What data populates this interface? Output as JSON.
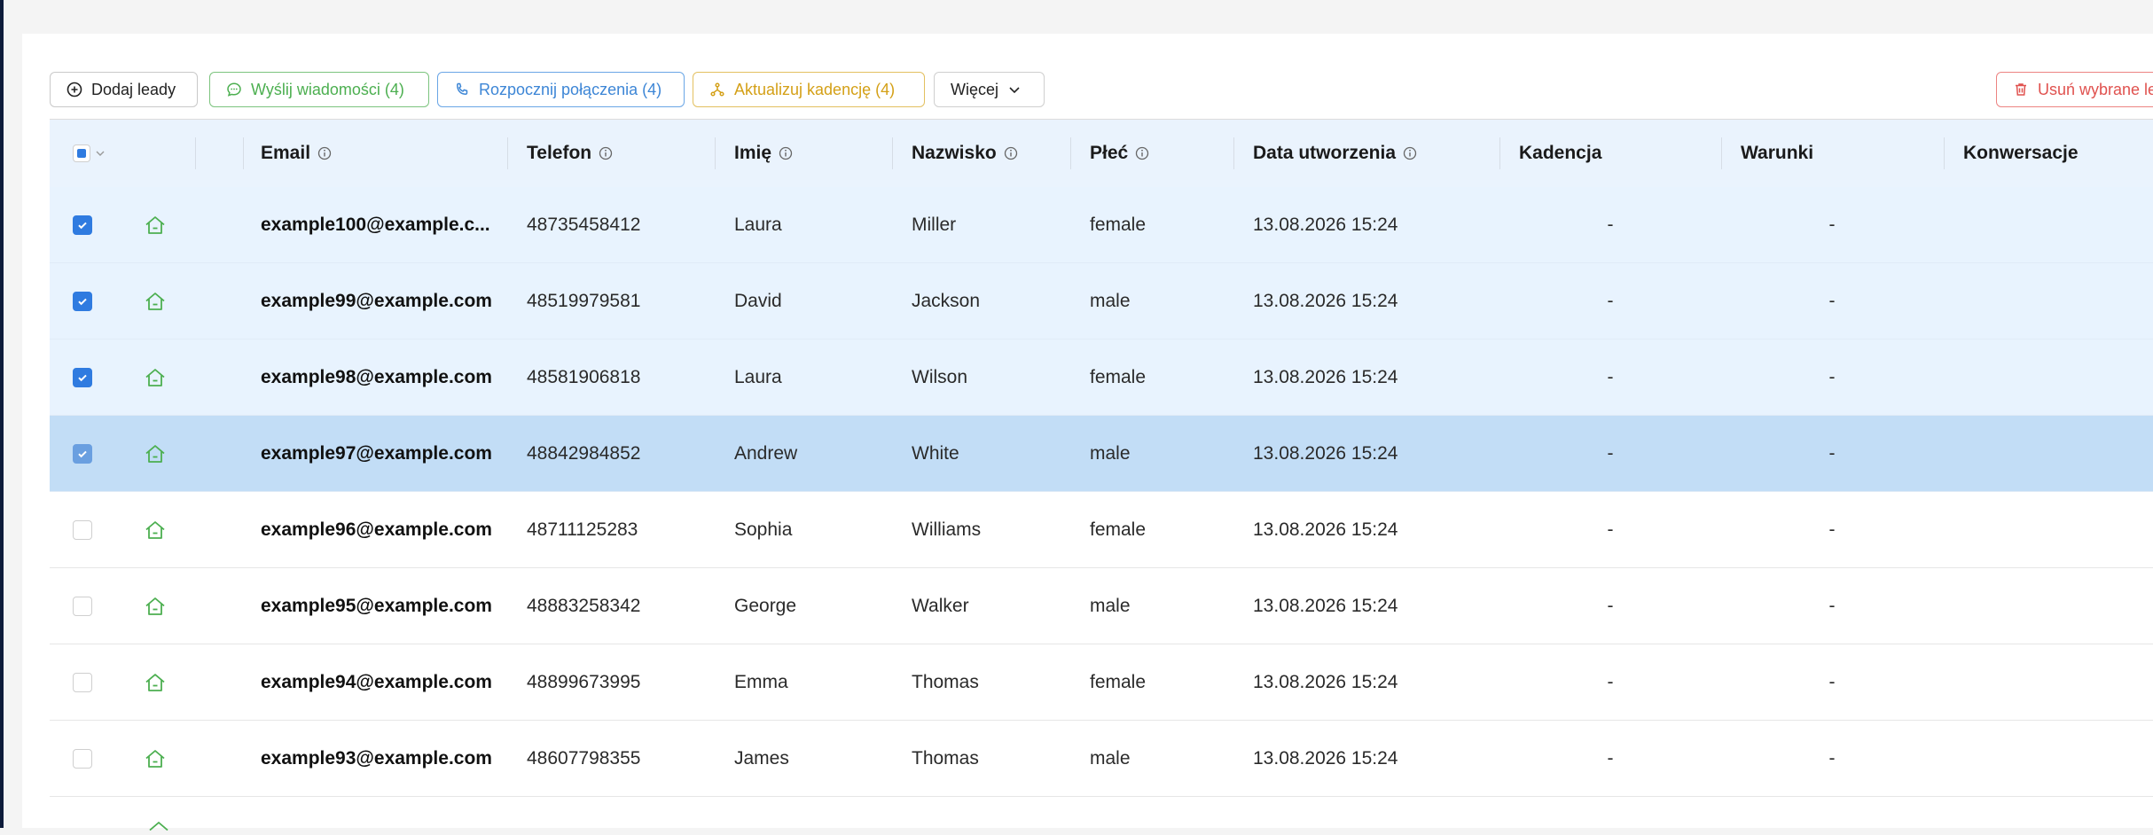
{
  "toolbar": {
    "add_label": "Dodaj leady",
    "send_label": "Wyślij wiadomości (4)",
    "call_label": "Rozpocznij połączenia (4)",
    "cadence_label": "Aktualizuj kadencję (4)",
    "more_label": "Więcej",
    "delete_label": "Usuń wybrane leady"
  },
  "columns": {
    "email": "Email",
    "phone": "Telefon",
    "first_name": "Imię",
    "last_name": "Nazwisko",
    "gender": "Płeć",
    "created": "Data utworzenia",
    "cadence": "Kadencja",
    "conditions": "Warunki",
    "conversations": "Konwersacje"
  },
  "rows": [
    {
      "email": "example100@example.c...",
      "phone": "48735458412",
      "first_name": "Laura",
      "last_name": "Miller",
      "gender": "female",
      "created": "13.08.2026 15:24",
      "cadence": "-",
      "conditions": "-",
      "checked": true
    },
    {
      "email": "example99@example.com",
      "phone": "48519979581",
      "first_name": "David",
      "last_name": "Jackson",
      "gender": "male",
      "created": "13.08.2026 15:24",
      "cadence": "-",
      "conditions": "-",
      "checked": true
    },
    {
      "email": "example98@example.com",
      "phone": "48581906818",
      "first_name": "Laura",
      "last_name": "Wilson",
      "gender": "female",
      "created": "13.08.2026 15:24",
      "cadence": "-",
      "conditions": "-",
      "checked": true
    },
    {
      "email": "example97@example.com",
      "phone": "48842984852",
      "first_name": "Andrew",
      "last_name": "White",
      "gender": "male",
      "created": "13.08.2026 15:24",
      "cadence": "-",
      "conditions": "-",
      "checked": true
    },
    {
      "email": "example96@example.com",
      "phone": "48711125283",
      "first_name": "Sophia",
      "last_name": "Williams",
      "gender": "female",
      "created": "13.08.2026 15:24",
      "cadence": "-",
      "conditions": "-",
      "checked": false
    },
    {
      "email": "example95@example.com",
      "phone": "48883258342",
      "first_name": "George",
      "last_name": "Walker",
      "gender": "male",
      "created": "13.08.2026 15:24",
      "cadence": "-",
      "conditions": "-",
      "checked": false
    },
    {
      "email": "example94@example.com",
      "phone": "48899673995",
      "first_name": "Emma",
      "last_name": "Thomas",
      "gender": "female",
      "created": "13.08.2026 15:24",
      "cadence": "-",
      "conditions": "-",
      "checked": false
    },
    {
      "email": "example93@example.com",
      "phone": "48607798355",
      "first_name": "James",
      "last_name": "Thomas",
      "gender": "male",
      "created": "13.08.2026 15:24",
      "cadence": "-",
      "conditions": "-",
      "checked": false
    }
  ],
  "icons": {
    "add": "plus-circle-icon",
    "send": "chat-bubble-icon",
    "call": "phone-icon",
    "cadence": "branch-icon",
    "more": "chevron-down-icon",
    "delete": "trash-icon",
    "lead_source": "home-icon",
    "info": "info-icon"
  },
  "colors": {
    "selected_row": "#e8f3fe",
    "hover_row": "#c2ddf6",
    "checkbox": "#2f7be0",
    "send": "#4caf50",
    "call": "#3d86d6",
    "cadence": "#d4a017",
    "delete": "#e0524f"
  }
}
